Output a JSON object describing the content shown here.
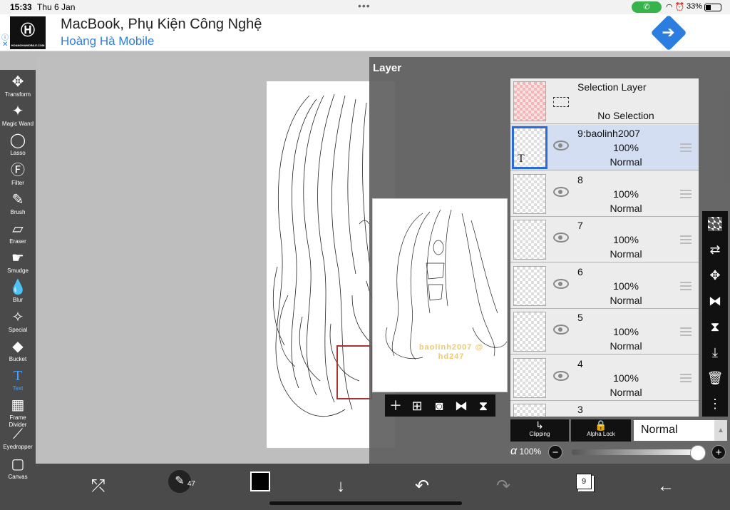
{
  "status": {
    "time": "15:33",
    "date": "Thu 6 Jan",
    "battery": "33%"
  },
  "ad": {
    "title": "MacBook, Phụ Kiện Công Nghệ",
    "subtitle": "Hoàng Hà Mobile"
  },
  "tools": [
    {
      "label": "Transform",
      "icon": "move-icon"
    },
    {
      "label": "Magic Wand",
      "icon": "magic-wand-icon"
    },
    {
      "label": "Lasso",
      "icon": "lasso-icon"
    },
    {
      "label": "Filter",
      "icon": "fx-icon"
    },
    {
      "label": "Brush",
      "icon": "brush-icon"
    },
    {
      "label": "Eraser",
      "icon": "eraser-icon"
    },
    {
      "label": "Smudge",
      "icon": "smudge-icon"
    },
    {
      "label": "Blur",
      "icon": "blur-drop-icon"
    },
    {
      "label": "Special",
      "icon": "special-icon"
    },
    {
      "label": "Bucket",
      "icon": "bucket-icon"
    },
    {
      "label": "Text",
      "icon": "text-icon"
    },
    {
      "label": "Frame Divider",
      "icon": "frame-divider-icon"
    },
    {
      "label": "Eyedropper",
      "icon": "eyedropper-icon"
    },
    {
      "label": "Canvas",
      "icon": "canvas-icon"
    }
  ],
  "layer_panel": {
    "title": "Layer",
    "selection_layer": {
      "name": "Selection Layer",
      "state": "No Selection"
    },
    "layers": [
      {
        "name": "9:baolinh2007",
        "opacity": "100%",
        "mode": "Normal",
        "selected": true,
        "text": true
      },
      {
        "name": "8",
        "opacity": "100%",
        "mode": "Normal"
      },
      {
        "name": "7",
        "opacity": "100%",
        "mode": "Normal"
      },
      {
        "name": "6",
        "opacity": "100%",
        "mode": "Normal"
      },
      {
        "name": "5",
        "opacity": "100%",
        "mode": "Normal"
      },
      {
        "name": "4",
        "opacity": "100%",
        "mode": "Normal"
      },
      {
        "name": "3",
        "opacity": "",
        "mode": ""
      }
    ],
    "clipping_label": "Clipping",
    "alpha_lock_label": "Alpha Lock",
    "blend_mode": "Normal",
    "alpha_symbol": "α",
    "alpha_value": "100%",
    "alpha_fraction": 1.0
  },
  "preview": {
    "watermark": "baolinh2007 @ hd247"
  },
  "bottombar": {
    "brush_size": "47",
    "layer_count": "9"
  },
  "colors": {
    "accent": "#4aa3ff",
    "selected_layer": "#d4def2",
    "toolbar": "#4a4a4a"
  }
}
